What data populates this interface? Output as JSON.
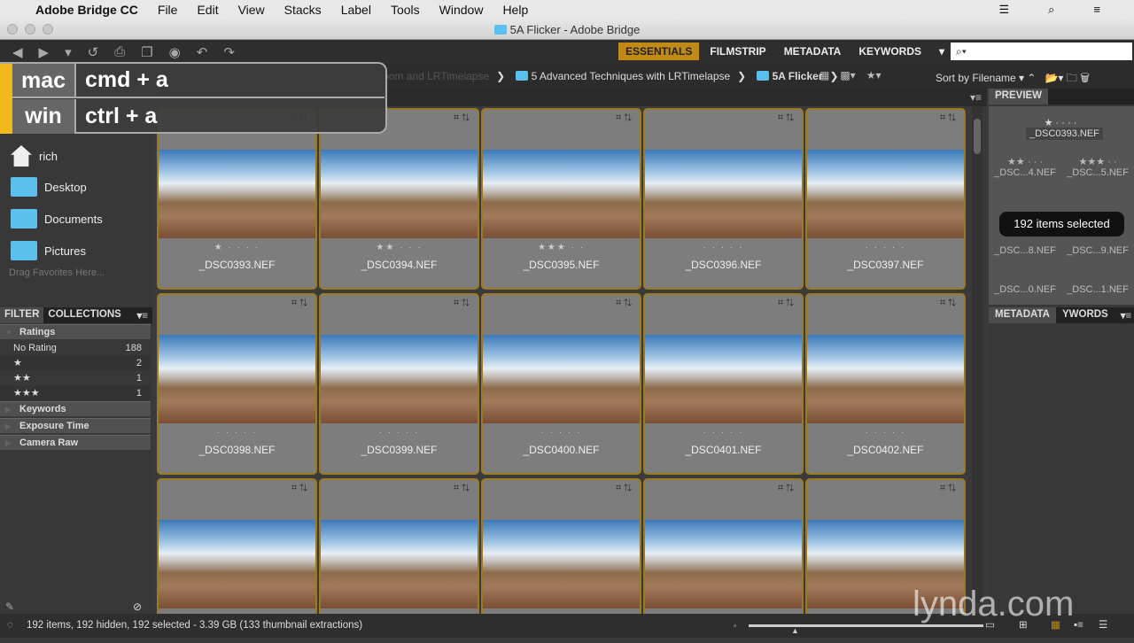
{
  "menubar": {
    "apple": "",
    "app": "Adobe Bridge CC",
    "items": [
      "File",
      "Edit",
      "View",
      "Stacks",
      "Label",
      "Tools",
      "Window",
      "Help"
    ]
  },
  "window": {
    "title": "5A Flicker - Adobe Bridge"
  },
  "workspaces": [
    "ESSENTIALS",
    "FILMSTRIP",
    "METADATA",
    "KEYWORDS"
  ],
  "search": {
    "placeholder": "⌕▾"
  },
  "breadcrumb": [
    "Creating Time Lapse Movies with Lightroom and LRTimelapse",
    "5 Advanced Techniques with LRTimelapse",
    "5A Flicker"
  ],
  "sort_label": "Sort by Filename",
  "overlay": {
    "rows": [
      {
        "os": "mac",
        "keys": "cmd + a"
      },
      {
        "os": "win",
        "keys": "ctrl + a"
      }
    ]
  },
  "favorites": [
    "rich",
    "Desktop",
    "Documents",
    "Pictures"
  ],
  "drag_favorites": "Drag Favorites Here...",
  "filter": {
    "tabs": [
      "FILTER",
      "COLLECTIONS"
    ],
    "ratings_label": "Ratings",
    "rows": [
      {
        "label": "No Rating",
        "count": "188"
      },
      {
        "label": "★",
        "count": "2"
      },
      {
        "label": "★★",
        "count": "1"
      },
      {
        "label": "★★★",
        "count": "1"
      }
    ],
    "groups": [
      "Keywords",
      "Exposure Time",
      "Camera Raw"
    ]
  },
  "thumbnails": [
    {
      "name": "_DSC0393.NEF",
      "stars": "★ · · · ·"
    },
    {
      "name": "_DSC0394.NEF",
      "stars": "★★ · · ·"
    },
    {
      "name": "_DSC0395.NEF",
      "stars": "★★★ · ·"
    },
    {
      "name": "_DSC0396.NEF",
      "stars": "· · · · ·"
    },
    {
      "name": "_DSC0397.NEF",
      "stars": "· · · · ·"
    },
    {
      "name": "_DSC0398.NEF",
      "stars": "· · · · ·"
    },
    {
      "name": "_DSC0399.NEF",
      "stars": "· · · · ·"
    },
    {
      "name": "_DSC0400.NEF",
      "stars": "· · · · ·"
    },
    {
      "name": "_DSC0401.NEF",
      "stars": "· · · · ·"
    },
    {
      "name": "_DSC0402.NEF",
      "stars": "· · · · ·"
    },
    {
      "name": "",
      "stars": ""
    },
    {
      "name": "",
      "stars": ""
    },
    {
      "name": "",
      "stars": ""
    },
    {
      "name": "",
      "stars": ""
    },
    {
      "name": "",
      "stars": ""
    }
  ],
  "preview": {
    "tab": "PREVIEW",
    "main": "_DSC0393.NEF",
    "items": [
      "_DSC...4.NEF",
      "_DSC...5.NEF",
      "_DSC...8.NEF",
      "_DSC...9.NEF",
      "_DSC...0.NEF",
      "_DSC...1.NEF"
    ],
    "toast": "192 items selected"
  },
  "metadata_tabs": [
    "METADATA",
    "YWORDS"
  ],
  "status": "192 items, 192 hidden, 192 selected - 3.39 GB (133 thumbnail extractions)",
  "watermark": "lynda.com",
  "colors": {
    "accent": "#c08a16",
    "selection": "#9c7a22",
    "overlay_bar": "#f2b91d"
  }
}
